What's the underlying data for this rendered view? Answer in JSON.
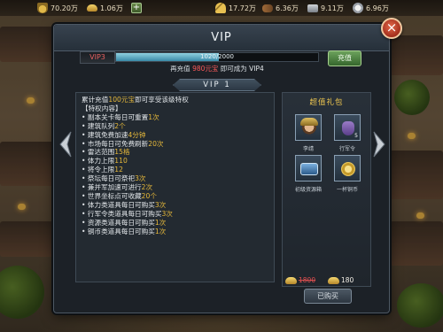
{
  "topbar": {
    "resources": [
      {
        "name": "food",
        "value": "70.20万"
      },
      {
        "name": "ingot",
        "value": "1.06万"
      },
      {
        "name": "wheat",
        "value": "17.72万"
      },
      {
        "name": "wood",
        "value": "6.36万"
      },
      {
        "name": "iron",
        "value": "9.11万"
      },
      {
        "name": "silver",
        "value": "6.96万"
      }
    ],
    "add_label": "+"
  },
  "panel": {
    "title": "VIP",
    "close_label": "×"
  },
  "vip": {
    "current_level": "VIP3",
    "progress_text": "1020/2000",
    "progress_fraction": 0.51,
    "hint_prefix": "再充值",
    "hint_amount": "980元宝",
    "hint_suffix": "即可成为",
    "next_level": "VIP4",
    "recharge_label": "充值"
  },
  "tab": {
    "label": "VIP 1"
  },
  "privileges": {
    "lines": [
      {
        "text": "累计充值",
        "value": "100元宝",
        "tail": "即可享受该级特权"
      },
      {
        "text": "【特权内容】",
        "value": "",
        "tail": ""
      },
      {
        "text": "• 副本关卡每日可重置",
        "value": "1次",
        "tail": ""
      },
      {
        "text": "• 建筑队列",
        "value": "2个",
        "tail": ""
      },
      {
        "text": "• 建筑免费加速",
        "value": "4分钟",
        "tail": ""
      },
      {
        "text": "• 市场每日可免费刷新",
        "value": "20次",
        "tail": ""
      },
      {
        "text": "• 雷达范围",
        "value": "15格",
        "tail": ""
      },
      {
        "text": "• 体力上限",
        "value": "110",
        "tail": ""
      },
      {
        "text": "• 将令上限",
        "value": "12",
        "tail": ""
      },
      {
        "text": "• 祭坛每日可祭祀",
        "value": "3次",
        "tail": ""
      },
      {
        "text": "• 兼并军加速可进行",
        "value": "2次",
        "tail": ""
      },
      {
        "text": "• 世界坐标点可收藏",
        "value": "20个",
        "tail": ""
      },
      {
        "text": "• 体力类道具每日可购买",
        "value": "3次",
        "tail": ""
      },
      {
        "text": "• 行军令类道具每日可购买",
        "value": "3次",
        "tail": ""
      },
      {
        "text": "• 资源类道具每日可购买",
        "value": "1次",
        "tail": ""
      },
      {
        "text": "• 铜币类道具每日可购买",
        "value": "1次",
        "tail": ""
      }
    ]
  },
  "gifts": {
    "title": "超值礼包",
    "items": [
      {
        "label": "李靖",
        "icon": "general-portrait-icon",
        "count": ""
      },
      {
        "label": "行军令",
        "icon": "march-order-icon",
        "count": "5"
      },
      {
        "label": "初级资源箱",
        "icon": "resource-chest-icon",
        "count": ""
      },
      {
        "label": "一杯铜币",
        "icon": "copper-coin-icon",
        "count": ""
      }
    ],
    "original_price": "1800",
    "price": "180",
    "buy_label": "已购买"
  }
}
